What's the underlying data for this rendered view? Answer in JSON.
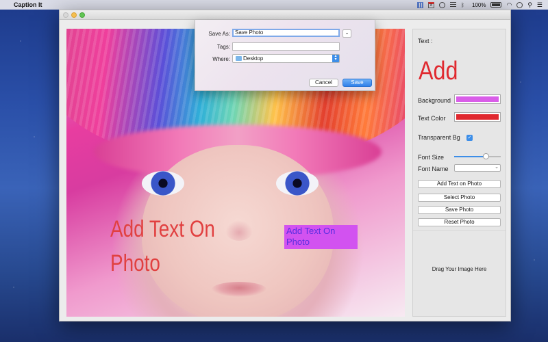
{
  "menubar": {
    "app_name": "Caption It",
    "battery": "100%",
    "calendar_day": "8"
  },
  "photo": {
    "caption_big": "Add Text On Photo",
    "caption_small": "Add Text On Photo"
  },
  "sidebar": {
    "text_label": "Text :",
    "preview_text": "Add",
    "background_label": "Background",
    "text_color_label": "Text Color",
    "transparent_label": "Transparent Bg",
    "font_size_label": "Font Size",
    "font_name_label": "Font Name",
    "add_text_button": "Add Text on Photo",
    "select_photo_button": "Select Photo",
    "save_photo_button": "Save Photo",
    "reset_photo_button": "Reset Photo",
    "drop_hint": "Drag Your Image Here",
    "background_color": "#d95ee8",
    "text_color": "#e0292f",
    "transparent_checked": true,
    "font_size_fraction": 0.7
  },
  "dialog": {
    "save_as_label": "Save As:",
    "save_as_value": "Save Photo",
    "tags_label": "Tags:",
    "tags_value": "",
    "where_label": "Where:",
    "where_value": "Desktop",
    "cancel_label": "Cancel",
    "save_label": "Save"
  }
}
